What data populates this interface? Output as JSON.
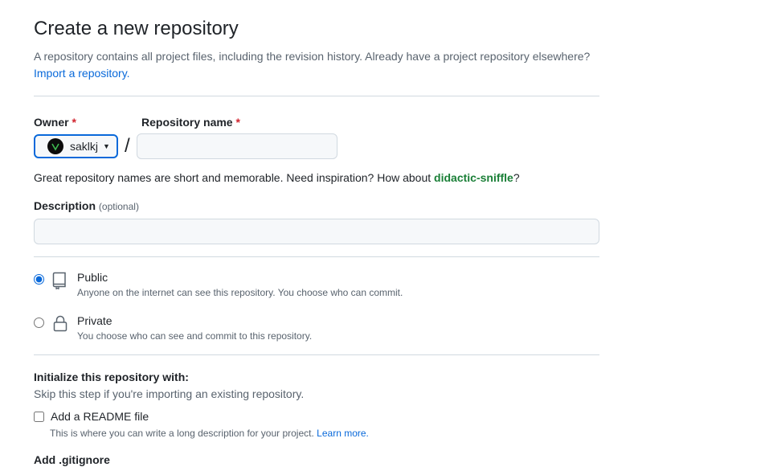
{
  "header": {
    "title": "Create a new repository",
    "description": "A repository contains all project files, including the revision history. Already have a project repository elsewhere?",
    "import_link": "Import a repository."
  },
  "owner": {
    "label": "Owner",
    "required_mark": "*",
    "selected": "saklkj"
  },
  "repo_name": {
    "label": "Repository name",
    "required_mark": "*",
    "value": "",
    "placeholder": ""
  },
  "slash": "/",
  "name_hint": {
    "text": "Great repository names are short and memorable. Need inspiration? How about ",
    "suggestion": "didactic-sniffle",
    "suffix": "?"
  },
  "description": {
    "label": "Description",
    "optional": "(optional)",
    "value": "",
    "placeholder": ""
  },
  "visibility": {
    "options": [
      {
        "title": "Public",
        "desc": "Anyone on the internet can see this repository. You choose who can commit.",
        "icon": "repo-icon",
        "selected": true
      },
      {
        "title": "Private",
        "desc": "You choose who can see and commit to this repository.",
        "icon": "lock-icon",
        "selected": false
      }
    ]
  },
  "initialize": {
    "title": "Initialize this repository with:",
    "subtitle": "Skip this step if you're importing an existing repository.",
    "readme": {
      "label": "Add a README file",
      "desc": "This is where you can write a long description for your project.",
      "learn_more": "Learn more.",
      "checked": false
    },
    "gitignore_label": "Add .gitignore"
  },
  "colors": {
    "accent": "#0969da",
    "suggestion": "#1a7f37",
    "required": "#d1242f"
  }
}
